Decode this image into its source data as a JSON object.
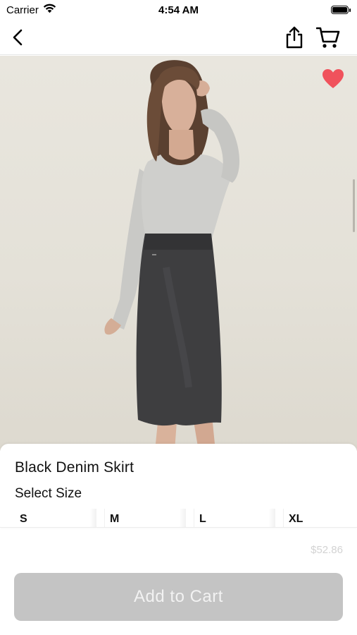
{
  "status_bar": {
    "carrier": "Carrier",
    "time": "4:54 AM",
    "icons": [
      "wifi-icon",
      "battery-icon"
    ]
  },
  "nav": {
    "icons": [
      "back-chevron-icon",
      "share-icon",
      "cart-icon"
    ]
  },
  "product": {
    "image": "woman wearing light grey long-sleeve top and black denim pencil skirt",
    "favorite": true,
    "favorite_color": "#f0525c",
    "title": "Black Denim Skirt",
    "size_heading": "Select Size",
    "sizes": [
      "S",
      "M",
      "L",
      "XL"
    ],
    "price": "$52.86"
  },
  "cart_button": {
    "label": "Add to Cart",
    "enabled": false,
    "color": "#c4c4c4"
  }
}
